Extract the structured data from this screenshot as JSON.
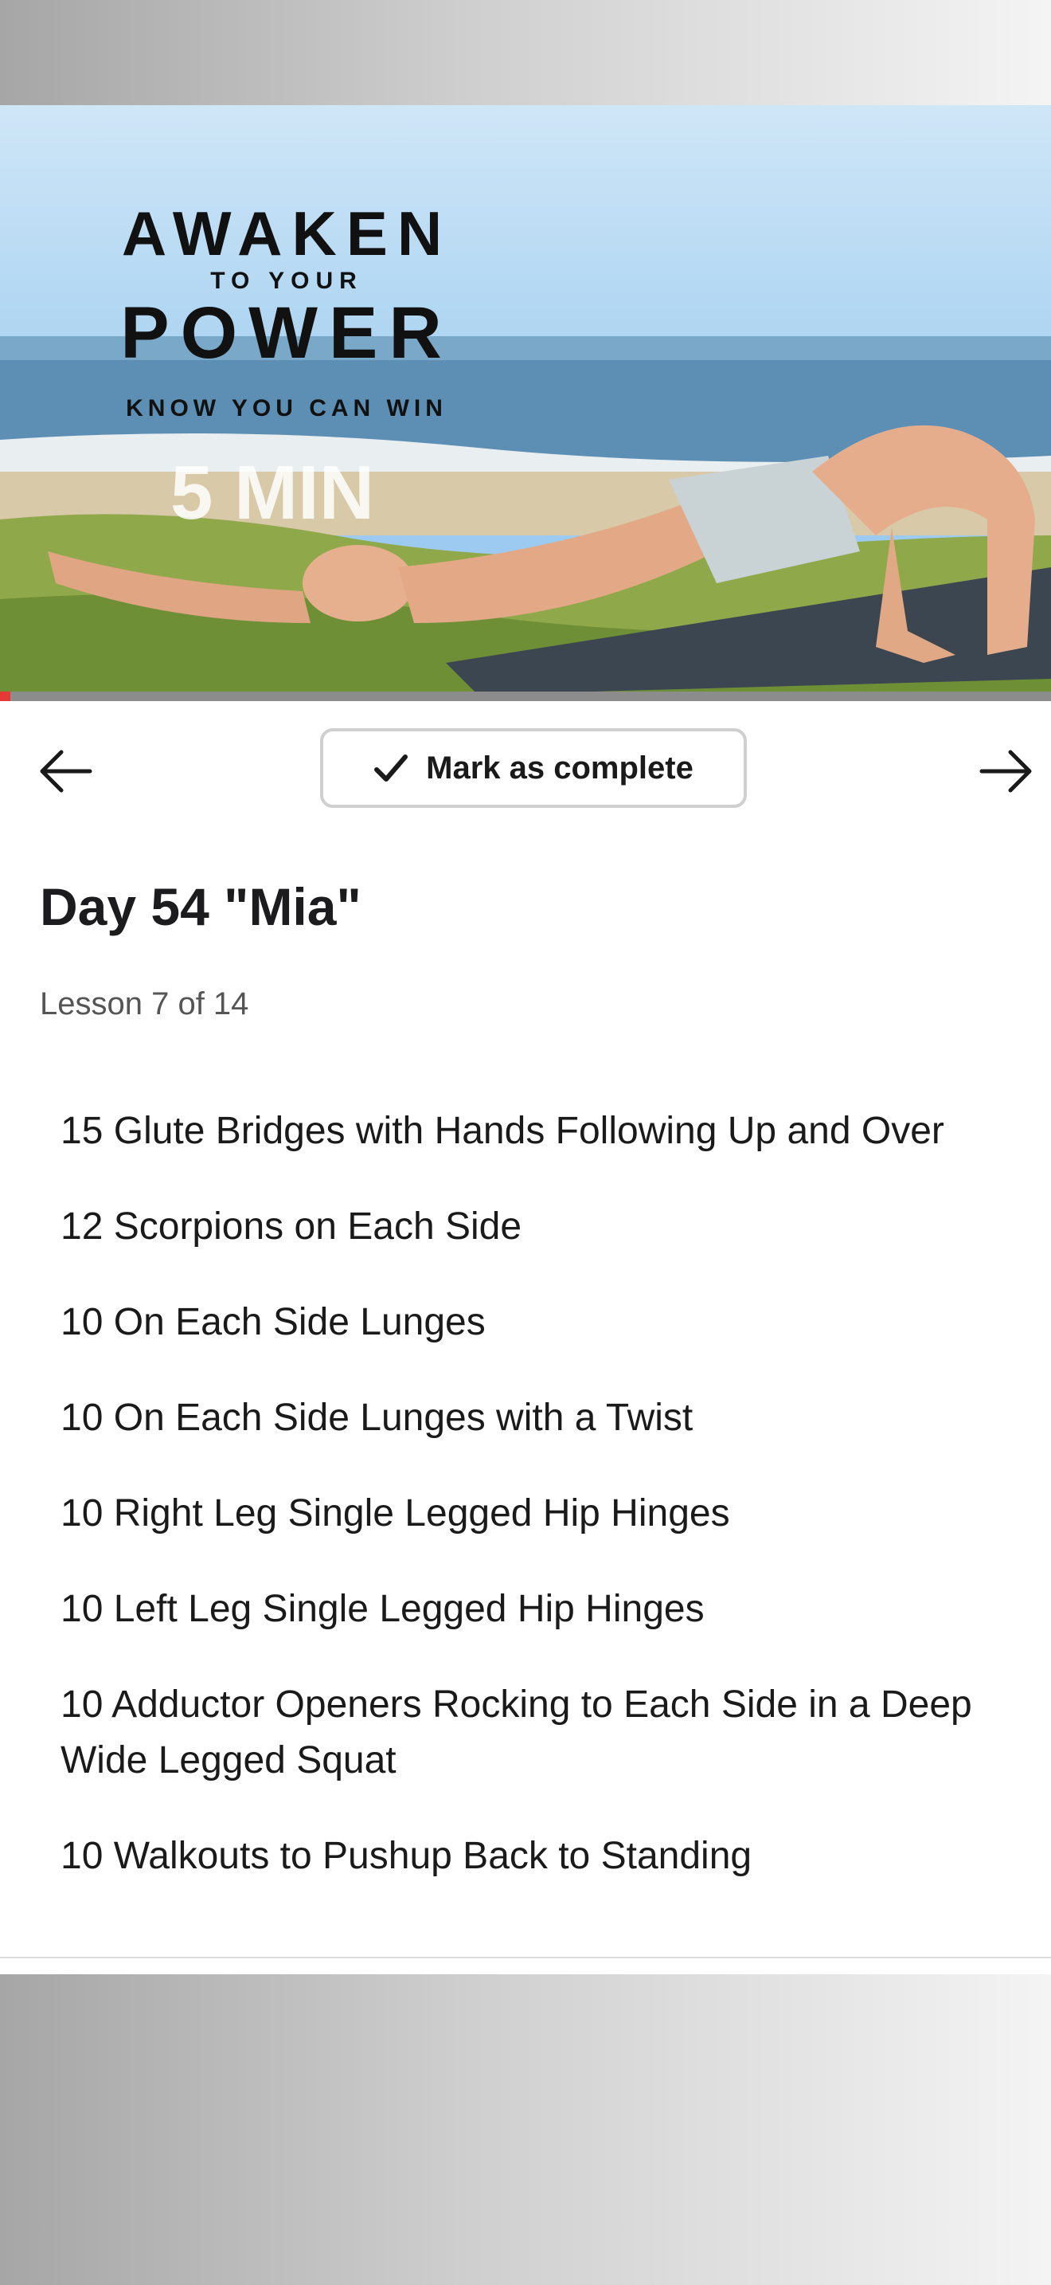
{
  "video": {
    "title_line1": "AWAKEN",
    "title_line2": "TO YOUR",
    "title_line3": "POWER",
    "tagline": "KNOW YOU CAN WIN",
    "duration": "5 MIN",
    "progress_percent": 1
  },
  "controls": {
    "prev_icon": "arrow-left-icon",
    "next_icon": "arrow-right-icon",
    "complete_icon": "checkmark-icon",
    "complete_label": "Mark as complete"
  },
  "lesson": {
    "title": "Day 54 \"Mia\"",
    "subtitle": "Lesson 7 of 14"
  },
  "exercises": [
    "15 Glute Bridges with Hands Following Up and Over",
    "12 Scorpions on Each Side",
    "10 On Each Side Lunges",
    "10 On Each Side Lunges with a Twist",
    "10 Right Leg Single Legged Hip Hinges",
    "10 Left Leg Single Legged Hip Hinges",
    "10 Adductor Openers Rocking to Each Side in a Deep Wide Legged Squat",
    "10 Walkouts to Pushup Back to Standing"
  ],
  "colors": {
    "progress": "#e53935",
    "text": "#1a1a1a"
  }
}
